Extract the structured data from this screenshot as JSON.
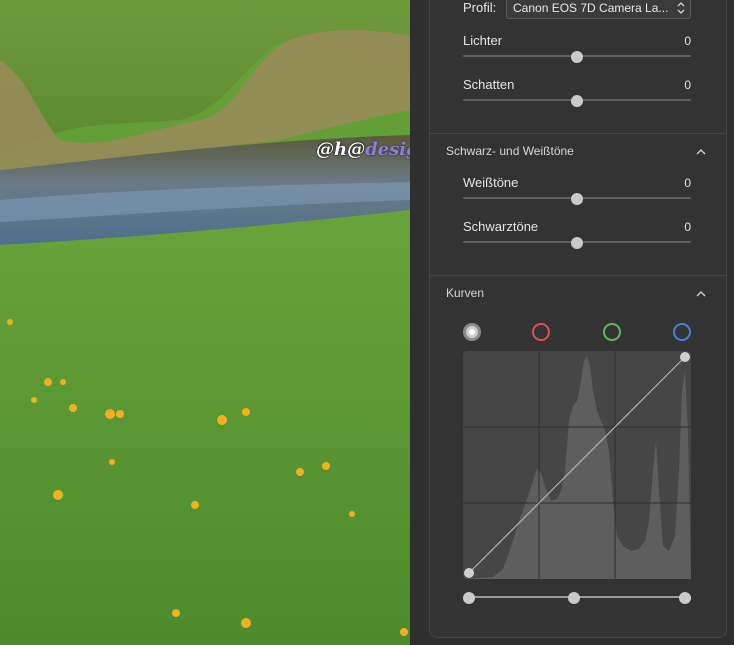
{
  "profile": {
    "label": "Profil:",
    "value": "Canon EOS 7D Camera La..."
  },
  "sliders": {
    "lichter": {
      "label": "Lichter",
      "value": "0"
    },
    "schatten": {
      "label": "Schatten",
      "value": "0"
    },
    "weisstoene": {
      "label": "Weißtöne",
      "value": "0"
    },
    "schwarztoene": {
      "label": "Schwarztöne",
      "value": "0"
    }
  },
  "sections": {
    "schwarz_weiss": {
      "title": "Schwarz- und Weißtöne"
    },
    "kurven": {
      "title": "Kurven"
    }
  },
  "curve_channels": [
    {
      "name": "rgb-channel",
      "color": "#ffffff",
      "selected": true
    },
    {
      "name": "red-channel",
      "color": "#d9534f",
      "selected": false
    },
    {
      "name": "green-channel",
      "color": "#5fb85f",
      "selected": false
    },
    {
      "name": "blue-channel",
      "color": "#4a7fe0",
      "selected": false
    }
  ],
  "watermark": {
    "part1": "@h@",
    "part2": "design.eu"
  },
  "colors": {
    "panel_bg": "#333333",
    "track": "#5f5f5f",
    "thumb": "#c9c9c9"
  }
}
